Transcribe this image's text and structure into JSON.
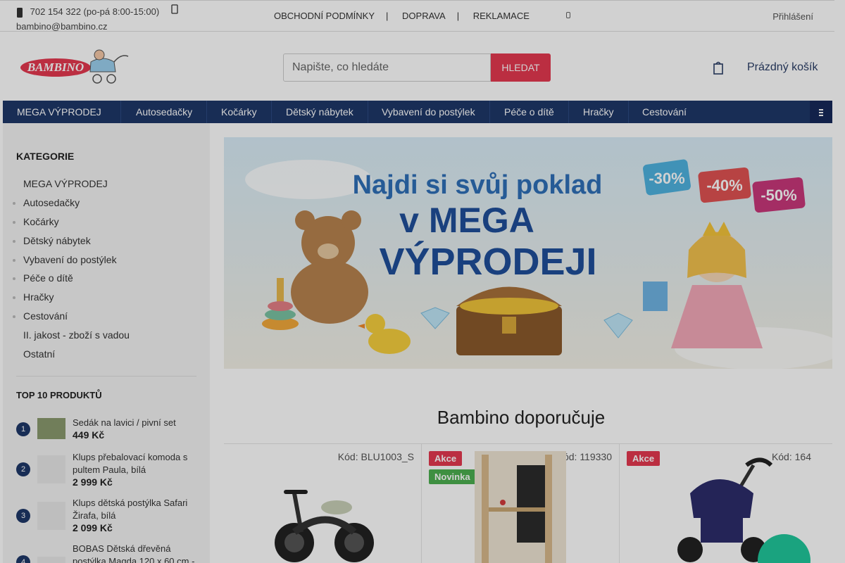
{
  "topbar": {
    "phone": "702 154 322 (po-pá 8:00-15:00)",
    "email": "bambino@bambino.cz",
    "links": [
      "OBCHODNÍ PODMÍNKY",
      "DOPRAVA",
      "REKLAMACE"
    ],
    "login": "Přihlášení"
  },
  "header": {
    "logo_text": "BAMBINO",
    "search_placeholder": "Napište, co hledáte",
    "search_button": "HLEDAT",
    "cart_label": "Prázdný košík"
  },
  "nav": {
    "items": [
      "MEGA VÝPRODEJ",
      "Autosedačky",
      "Kočárky",
      "Dětský nábytek",
      "Vybavení do postýlek",
      "Péče o dítě",
      "Hračky",
      "Cestování"
    ]
  },
  "sidebar": {
    "title": "KATEGORIE",
    "categories": [
      "MEGA VÝPRODEJ",
      "Autosedačky",
      "Kočárky",
      "Dětský nábytek",
      "Vybavení do postýlek",
      "Péče o dítě",
      "Hračky",
      "Cestování",
      "II. jakost - zboží s vadou",
      "Ostatní"
    ],
    "top10_title": "TOP 10 PRODUKTŮ",
    "top10": [
      {
        "rank": "1",
        "name": "Sedák na lavici / pivní set",
        "price": "449 Kč"
      },
      {
        "rank": "2",
        "name": "Klups přebalovací komoda s pultem Paula, bílá",
        "price": "2 999 Kč"
      },
      {
        "rank": "3",
        "name": "Klups dětská postýlka Safari Žirafa, bílá",
        "price": "2 099 Kč"
      },
      {
        "rank": "4",
        "name": "BOBAS Dětská dřevěná postýlka Magda 120 x 60 cm -",
        "price": ""
      }
    ]
  },
  "banner": {
    "line1": "Najdi si svůj poklad",
    "line2": "v MEGA",
    "line3": "VÝPRODEJI",
    "tags": [
      "-30%",
      "-40%",
      "-50%"
    ]
  },
  "section_title": "Bambino doporučuje",
  "products": [
    {
      "code": "Kód: BLU1003_S",
      "badges": []
    },
    {
      "code": "Kód: 119330",
      "badges": [
        "Akce",
        "Novinka"
      ]
    },
    {
      "code": "Kód: 164",
      "badges": [
        "Akce"
      ]
    }
  ],
  "colors": {
    "navy": "#1e3768",
    "accent": "#e53950",
    "green": "#4caf50",
    "chat": "#1aa37f"
  }
}
